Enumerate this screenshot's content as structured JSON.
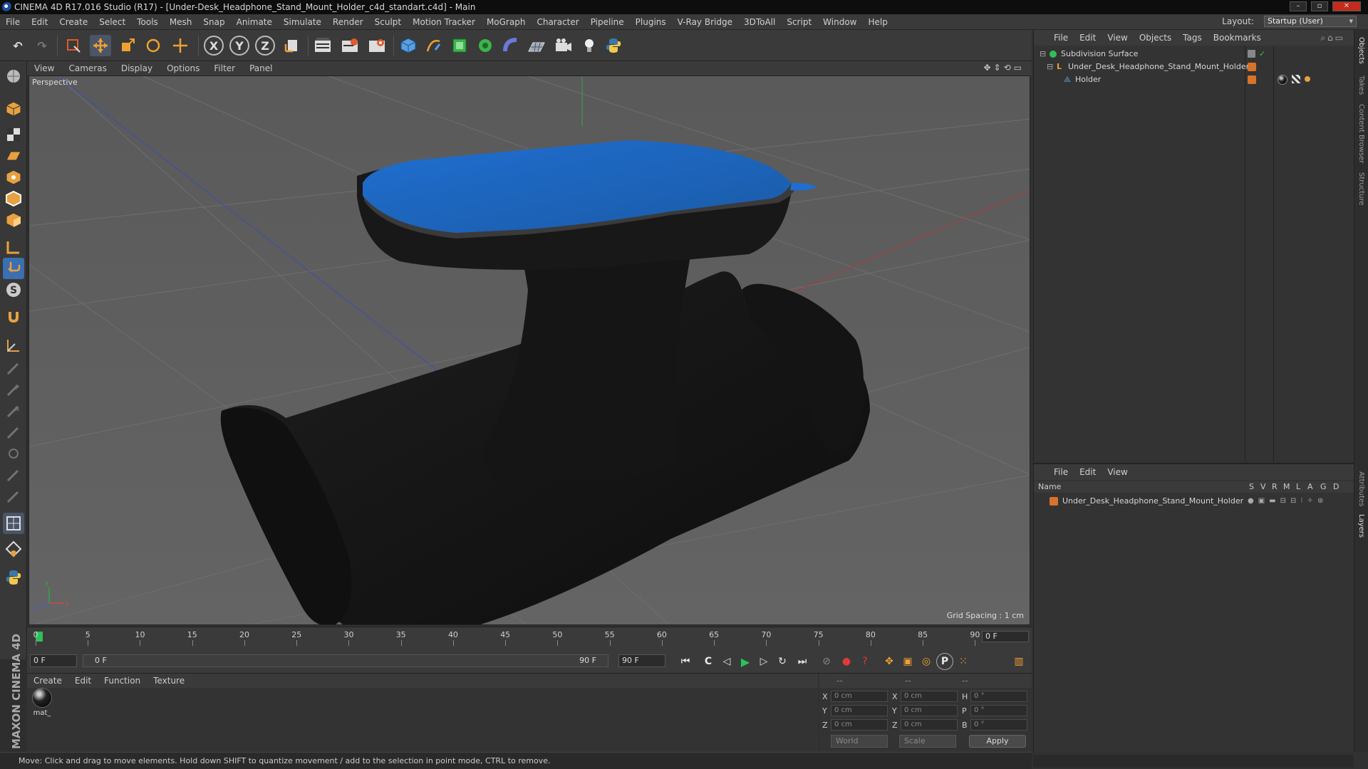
{
  "window": {
    "title": "CINEMA 4D R17.016 Studio (R17) - [Under-Desk_Headphone_Stand_Mount_Holder_c4d_standart.c4d] - Main"
  },
  "menubar": {
    "items": [
      "File",
      "Edit",
      "Create",
      "Select",
      "Tools",
      "Mesh",
      "Snap",
      "Animate",
      "Simulate",
      "Render",
      "Sculpt",
      "Motion Tracker",
      "MoGraph",
      "Character",
      "Pipeline",
      "Plugins",
      "V-Ray Bridge",
      "3DToAll",
      "Script",
      "Window",
      "Help"
    ],
    "layout_label": "Layout:",
    "layout_value": "Startup (User)"
  },
  "toolbar": {
    "axis": [
      "X",
      "Y",
      "Z"
    ]
  },
  "viewport": {
    "menu": [
      "View",
      "Cameras",
      "Display",
      "Options",
      "Filter",
      "Panel"
    ],
    "camera": "Perspective",
    "grid_spacing": "Grid Spacing : 1 cm"
  },
  "timeline": {
    "ticks": [
      "0",
      "5",
      "10",
      "15",
      "20",
      "25",
      "30",
      "35",
      "40",
      "45",
      "50",
      "55",
      "60",
      "65",
      "70",
      "75",
      "80",
      "85",
      "90"
    ],
    "current": "0 F"
  },
  "transport": {
    "start": "0 F",
    "range_start": "0 F",
    "range_end": "90 F",
    "end": "90 F"
  },
  "material_manager": {
    "menu": [
      "Create",
      "Edit",
      "Function",
      "Texture"
    ],
    "materials": [
      "mat_"
    ]
  },
  "coordinates": {
    "headers": [
      "--",
      "--",
      "--"
    ],
    "rows": [
      {
        "l1": "X",
        "v1": "0 cm",
        "l2": "X",
        "v2": "0 cm",
        "l3": "H",
        "v3": "0 °"
      },
      {
        "l1": "Y",
        "v1": "0 cm",
        "l2": "Y",
        "v2": "0 cm",
        "l3": "P",
        "v3": "0 °"
      },
      {
        "l1": "Z",
        "v1": "0 cm",
        "l2": "Z",
        "v2": "0 cm",
        "l3": "B",
        "v3": "0 °"
      }
    ],
    "mode": "World",
    "size_mode": "Scale",
    "apply": "Apply"
  },
  "status": "Move: Click and drag to move elements. Hold down SHIFT to quantize movement / add to the selection in point mode, CTRL to remove.",
  "objects": {
    "menu": [
      "File",
      "Edit",
      "View",
      "Objects",
      "Tags",
      "Bookmarks"
    ],
    "items": [
      "Subdivision Surface",
      "Under_Desk_Headphone_Stand_Mount_Holder",
      "Holder"
    ]
  },
  "layers": {
    "menu": [
      "File",
      "Edit",
      "View"
    ],
    "name_header": "Name",
    "flags": [
      "S",
      "V",
      "R",
      "M",
      "L",
      "A",
      "G",
      "D"
    ],
    "items": [
      "Under_Desk_Headphone_Stand_Mount_Holder"
    ]
  },
  "side_tabs": [
    "Objects",
    "Takes",
    "Content Browser",
    "Structure",
    "Attributes",
    "Layers"
  ],
  "logo": {
    "text": "MAXON CINEMA 4D"
  },
  "colors": {
    "accent": "#1f6fd1",
    "object_top": "#1f5fa8",
    "layer_color": "#d9732a"
  }
}
